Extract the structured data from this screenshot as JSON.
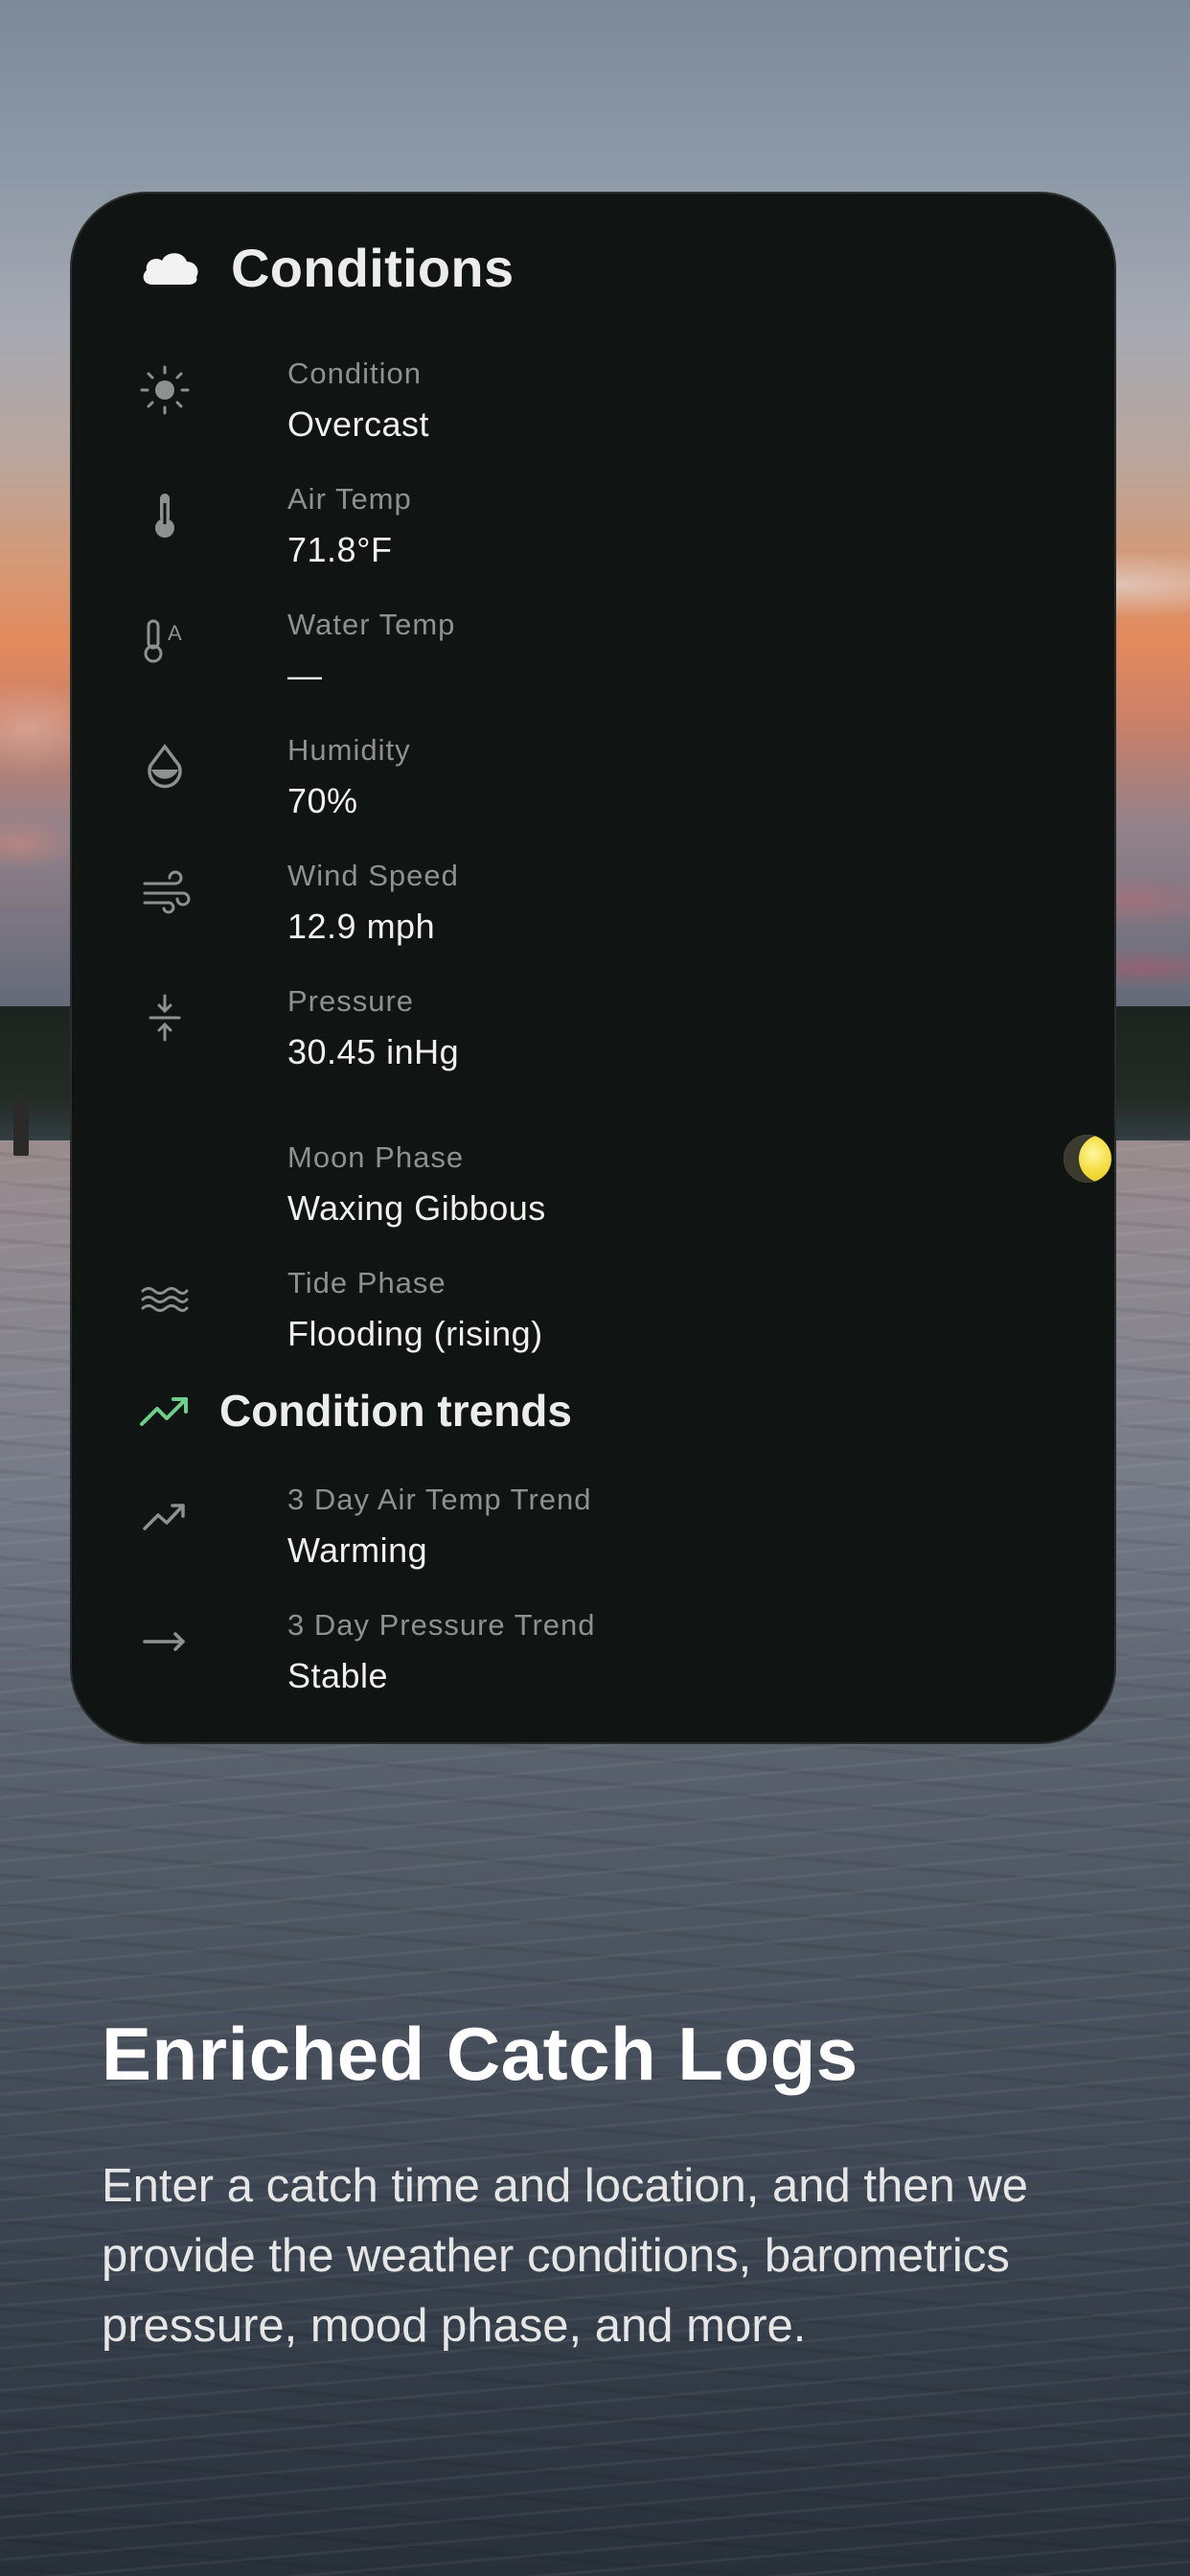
{
  "card": {
    "title": "Conditions",
    "title_icon": "cloud-icon",
    "rows": [
      {
        "icon": "sun-icon",
        "label": "Condition",
        "value": "Overcast"
      },
      {
        "icon": "thermometer-icon",
        "label": "Air Temp",
        "value": "71.8°F"
      },
      {
        "icon": "water-thermometer-icon",
        "label": "Water Temp",
        "value": "—"
      },
      {
        "icon": "humidity-drop-icon",
        "label": "Humidity",
        "value": "70%"
      },
      {
        "icon": "wind-icon",
        "label": "Wind Speed",
        "value": "12.9 mph"
      },
      {
        "icon": "pressure-icon",
        "label": "Pressure",
        "value": "30.45 inHg"
      },
      {
        "icon": "crescent-moon-icon",
        "label": "Moon Phase",
        "value": "Waxing Gibbous"
      },
      {
        "icon": "waves-icon",
        "label": "Tide Phase",
        "value": "Flooding (rising)"
      }
    ],
    "trends": {
      "title": "Condition trends",
      "title_icon": "trending-up-icon",
      "rows": [
        {
          "icon": "trending-up-icon",
          "label": "3 Day Air Temp Trend",
          "value": "Warming"
        },
        {
          "icon": "arrow-right-icon",
          "label": "3 Day Pressure Trend",
          "value": "Stable"
        }
      ]
    }
  },
  "colors": {
    "card_bg": "#101412",
    "accent_green": "#6fcf8a",
    "moon_yellow": "#f3dc3a"
  },
  "marketing": {
    "headline": "Enriched Catch Logs",
    "description": "Enter a catch time and location, and then we provide the weather conditions, barometrics pressure, mood phase, and more."
  }
}
